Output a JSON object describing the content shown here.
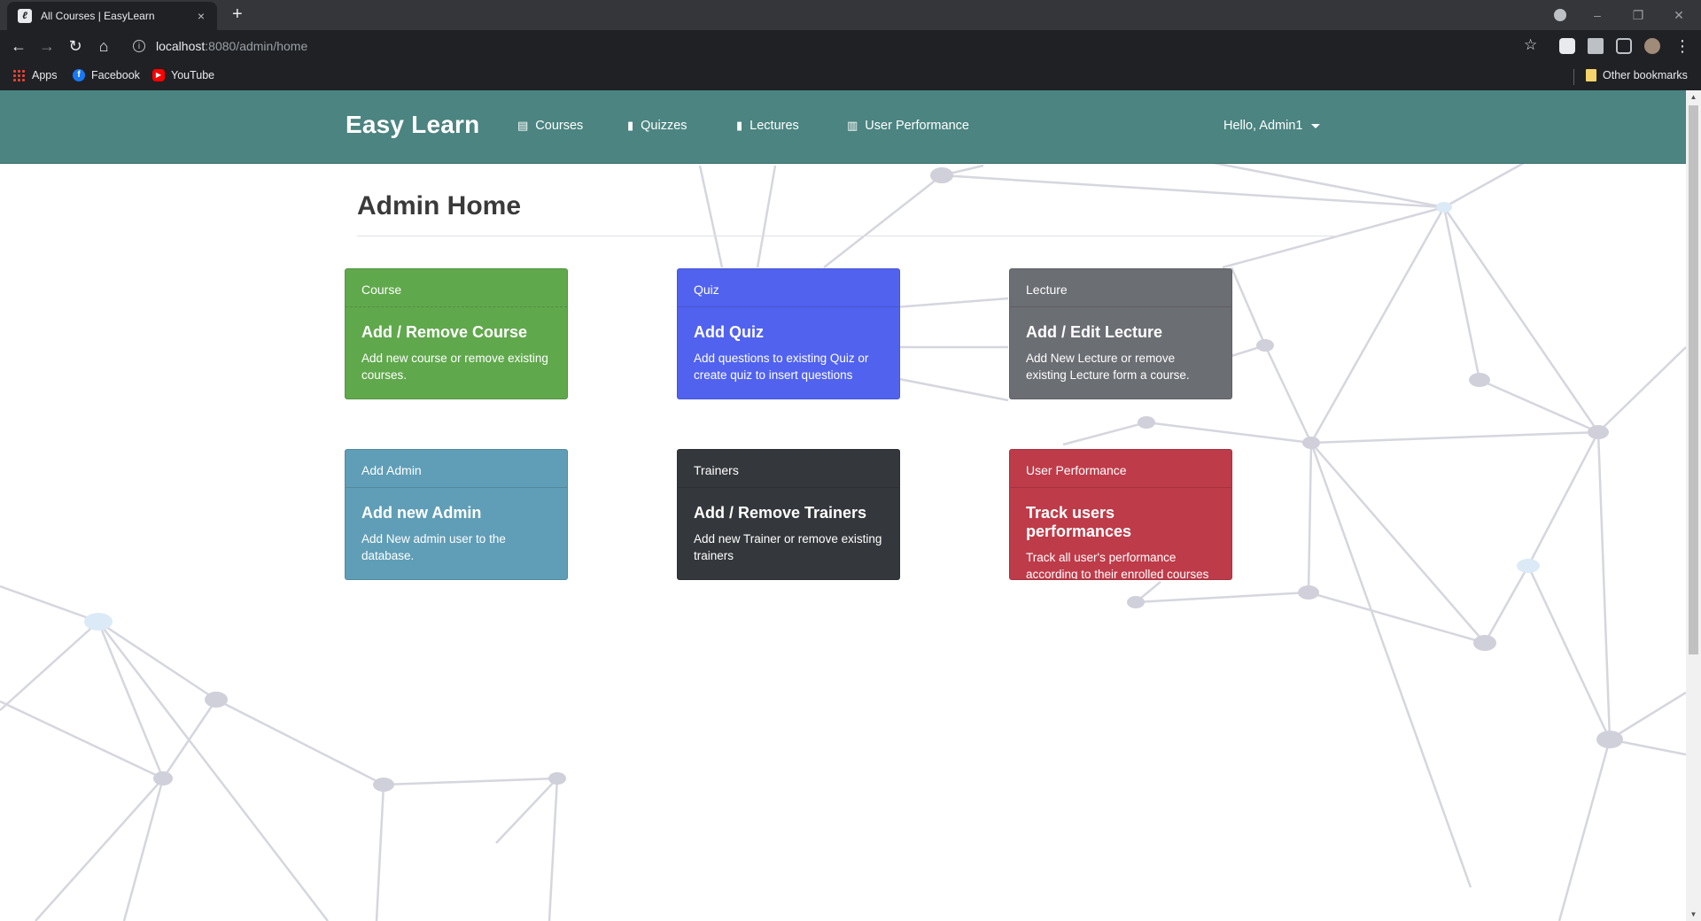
{
  "browser": {
    "tab_title": "All Courses | EasyLearn",
    "tab_close": "×",
    "new_tab": "+",
    "url_host": "localhost",
    "url_path": ":8080/admin/home",
    "bookmarks": [
      "Apps",
      "Facebook",
      "YouTube"
    ],
    "other_bookmarks": "Other bookmarks",
    "window_controls": [
      "–",
      "❐",
      "✕"
    ]
  },
  "navbar": {
    "brand": "Easy Learn",
    "links": [
      {
        "label": "Courses",
        "icon": "book-icon"
      },
      {
        "label": "Quizzes",
        "icon": "clipboard-icon"
      },
      {
        "label": "Lectures",
        "icon": "clipboard-icon"
      },
      {
        "label": "User Performance",
        "icon": "bar-chart-icon"
      }
    ],
    "user_menu": "Hello, Admin1"
  },
  "main": {
    "title": "Admin Home",
    "cards": [
      {
        "header": "Course",
        "title": "Add / Remove Course",
        "text": "Add new course or remove existing courses.",
        "color": "#60a84c"
      },
      {
        "header": "Quiz",
        "title": "Add Quiz",
        "text": "Add questions to existing Quiz or create quiz to insert questions",
        "color": "#5162ef"
      },
      {
        "header": "Lecture",
        "title": "Add / Edit Lecture",
        "text": "Add New Lecture or remove existing Lecture form a course.",
        "color": "#6b6e73"
      },
      {
        "header": "Add Admin",
        "title": "Add new Admin",
        "text": "Add New admin user to the database.",
        "color": "#5f9eb6"
      },
      {
        "header": "Trainers",
        "title": "Add / Remove Trainers",
        "text": "Add new Trainer or remove existing trainers",
        "color": "#34373b"
      },
      {
        "header": "User Performance",
        "title": "Track users performances",
        "text": "Track all user's performance according to their enrolled courses",
        "color": "#be3b49"
      }
    ]
  }
}
